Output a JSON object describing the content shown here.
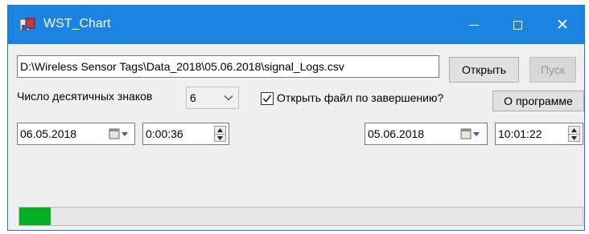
{
  "window": {
    "title": "WST_Chart",
    "minimize_icon": "minimize-icon",
    "maximize_icon": "maximize-icon",
    "close_icon": "close-icon"
  },
  "file": {
    "path": "D:\\Wireless Sensor Tags\\Data_2018\\05.06.2018\\signal_Logs.csv",
    "open_label": "Открыть",
    "start_label": "Пуск"
  },
  "options": {
    "decimals_label": "Число десятичных знаков",
    "decimals_value": "6",
    "open_on_finish_label": "Открыть файл по завершению?",
    "open_on_finish_checked": true,
    "about_label": "О программе"
  },
  "range": {
    "start_date": "06.05.2018",
    "start_time": "0:00:36",
    "end_date": "05.06.2018",
    "end_time": "10:01:22"
  },
  "progress": {
    "fraction": 0.055,
    "color": "#06b025"
  },
  "colors": {
    "titlebar": "#1a84e0"
  }
}
